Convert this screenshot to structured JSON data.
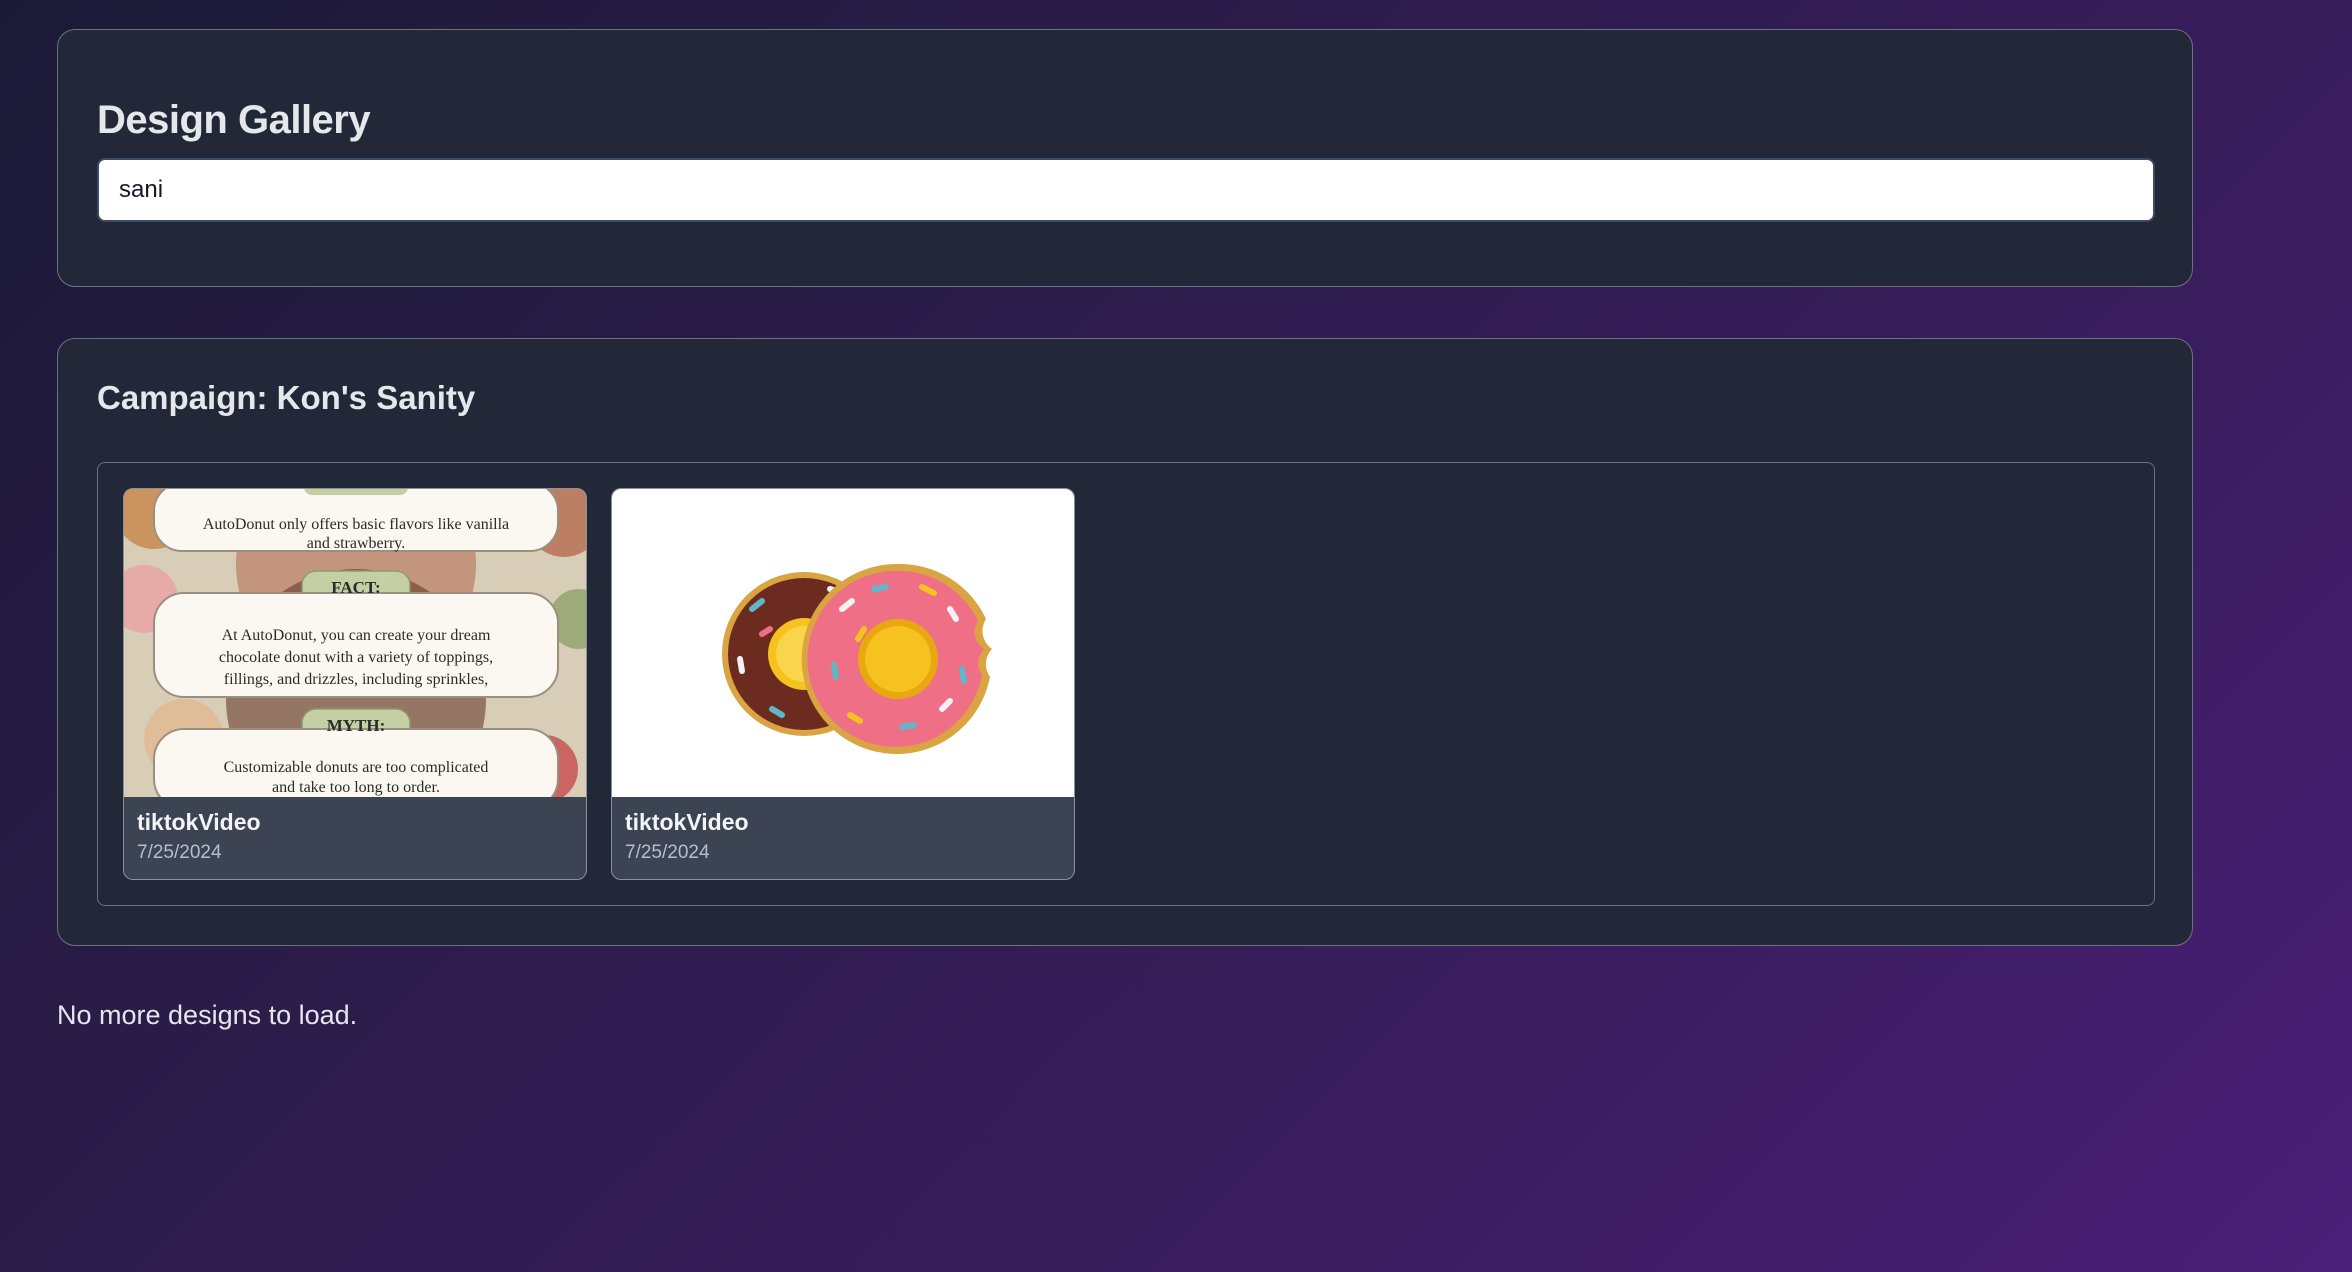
{
  "header": {
    "title": "Design Gallery"
  },
  "search": {
    "value": "sani",
    "placeholder": ""
  },
  "campaign": {
    "title": "Campaign: Kon's Sanity",
    "designs": [
      {
        "title": "tiktokVideo",
        "date": "7/25/2024",
        "thumbnail_text": [
          "AutoDonut only offers basic flavors like vanilla",
          "and strawberry.",
          "FACT:",
          "At AutoDonut, you can create your dream",
          "chocolate donut with a variety of toppings,",
          "fillings, and drizzles, including sprinkles,",
          "MYTH:",
          "Customizable donuts are too complicated",
          "and take too long to order."
        ]
      },
      {
        "title": "tiktokVideo",
        "date": "7/25/2024"
      }
    ]
  },
  "status": {
    "message": "No more designs to load."
  },
  "colors": {
    "panel_bg": "#222837",
    "card_bg": "#3c4352",
    "border": "#6b7280",
    "chocolate_donut": "#6b2c1f",
    "pink_donut": "#ee6f86",
    "donut_hole": "#f6c21f"
  }
}
